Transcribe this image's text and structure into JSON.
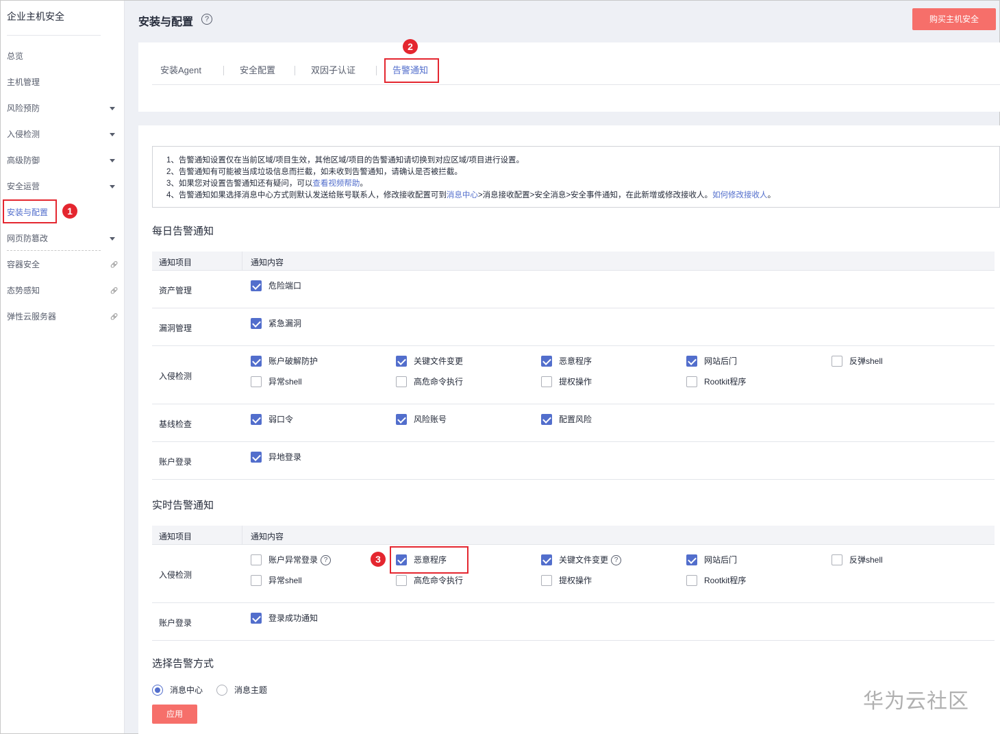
{
  "sidebar": {
    "title": "企业主机安全",
    "items": [
      {
        "label": "总览",
        "type": "plain"
      },
      {
        "label": "主机管理",
        "type": "plain"
      },
      {
        "label": "风险预防",
        "type": "arrow"
      },
      {
        "label": "入侵检测",
        "type": "arrow"
      },
      {
        "label": "高级防御",
        "type": "arrow"
      },
      {
        "label": "安全运营",
        "type": "arrow"
      },
      {
        "label": "安装与配置",
        "type": "active"
      },
      {
        "label": "网页防篡改",
        "type": "arrow"
      },
      {
        "label": "容器安全",
        "type": "link"
      },
      {
        "label": "态势感知",
        "type": "link"
      },
      {
        "label": "弹性云服务器",
        "type": "link"
      }
    ]
  },
  "header": {
    "title": "安装与配置",
    "help": "?",
    "buy_label": "购买主机安全"
  },
  "tabs": [
    "安装Agent",
    "安全配置",
    "双因子认证",
    "告警通知"
  ],
  "badges": [
    "1",
    "2",
    "3"
  ],
  "notice": {
    "line1": "1、告警通知设置仅在当前区域/项目生效，其他区域/项目的告警通知请切换到对应区域/项目进行设置。",
    "line2": "2、告警通知有可能被当成垃圾信息而拦截，如未收到告警通知，请确认是否被拦截。",
    "line3_pre": "3、如果您对设置告警通知还有疑问，可以",
    "line3_link": "查看视频帮助",
    "line3_post": "。",
    "line4_pre": "4、告警通知如果选择消息中心方式则默认发送给账号联系人，修改接收配置可到",
    "line4_link1": "消息中心",
    "line4_mid": ">消息接收配置>安全消息>安全事件通知，在此新增或修改接收人。",
    "line4_link2": "如何修改接收人",
    "line4_post": "。"
  },
  "daily": {
    "title": "每日告警通知",
    "col_item": "通知项目",
    "col_content": "通知内容",
    "rows": [
      {
        "label": "资产管理",
        "options": [
          {
            "label": "危险端口",
            "checked": true
          }
        ]
      },
      {
        "label": "漏洞管理",
        "options": [
          {
            "label": "紧急漏洞",
            "checked": true
          }
        ]
      },
      {
        "label": "入侵检测",
        "options": [
          {
            "label": "账户破解防护",
            "checked": true
          },
          {
            "label": "关键文件变更",
            "checked": true
          },
          {
            "label": "恶意程序",
            "checked": true
          },
          {
            "label": "网站后门",
            "checked": true
          },
          {
            "label": "反弹shell",
            "checked": false
          },
          {
            "label": "异常shell",
            "checked": false
          },
          {
            "label": "高危命令执行",
            "checked": false
          },
          {
            "label": "提权操作",
            "checked": false
          },
          {
            "label": "Rootkit程序",
            "checked": false
          }
        ]
      },
      {
        "label": "基线检查",
        "options": [
          {
            "label": "弱口令",
            "checked": true
          },
          {
            "label": "风险账号",
            "checked": true
          },
          {
            "label": "配置风险",
            "checked": true
          }
        ]
      },
      {
        "label": "账户登录",
        "options": [
          {
            "label": "异地登录",
            "checked": true
          }
        ]
      }
    ]
  },
  "realtime": {
    "title": "实时告警通知",
    "col_item": "通知项目",
    "col_content": "通知内容",
    "rows": [
      {
        "label": "入侵检测",
        "options": [
          {
            "label": "账户异常登录",
            "checked": false,
            "help": true
          },
          {
            "label": "恶意程序",
            "checked": true
          },
          {
            "label": "关键文件变更",
            "checked": true,
            "help": true
          },
          {
            "label": "网站后门",
            "checked": true
          },
          {
            "label": "反弹shell",
            "checked": false
          },
          {
            "label": "异常shell",
            "checked": false
          },
          {
            "label": "高危命令执行",
            "checked": false
          },
          {
            "label": "提权操作",
            "checked": false
          },
          {
            "label": "Rootkit程序",
            "checked": false
          }
        ]
      },
      {
        "label": "账户登录",
        "options": [
          {
            "label": "登录成功通知",
            "checked": true
          }
        ]
      }
    ]
  },
  "method": {
    "title": "选择告警方式",
    "options": [
      {
        "label": "消息中心",
        "selected": true
      },
      {
        "label": "消息主题",
        "selected": false
      }
    ],
    "apply_label": "应用"
  },
  "watermark": "华为云社区"
}
